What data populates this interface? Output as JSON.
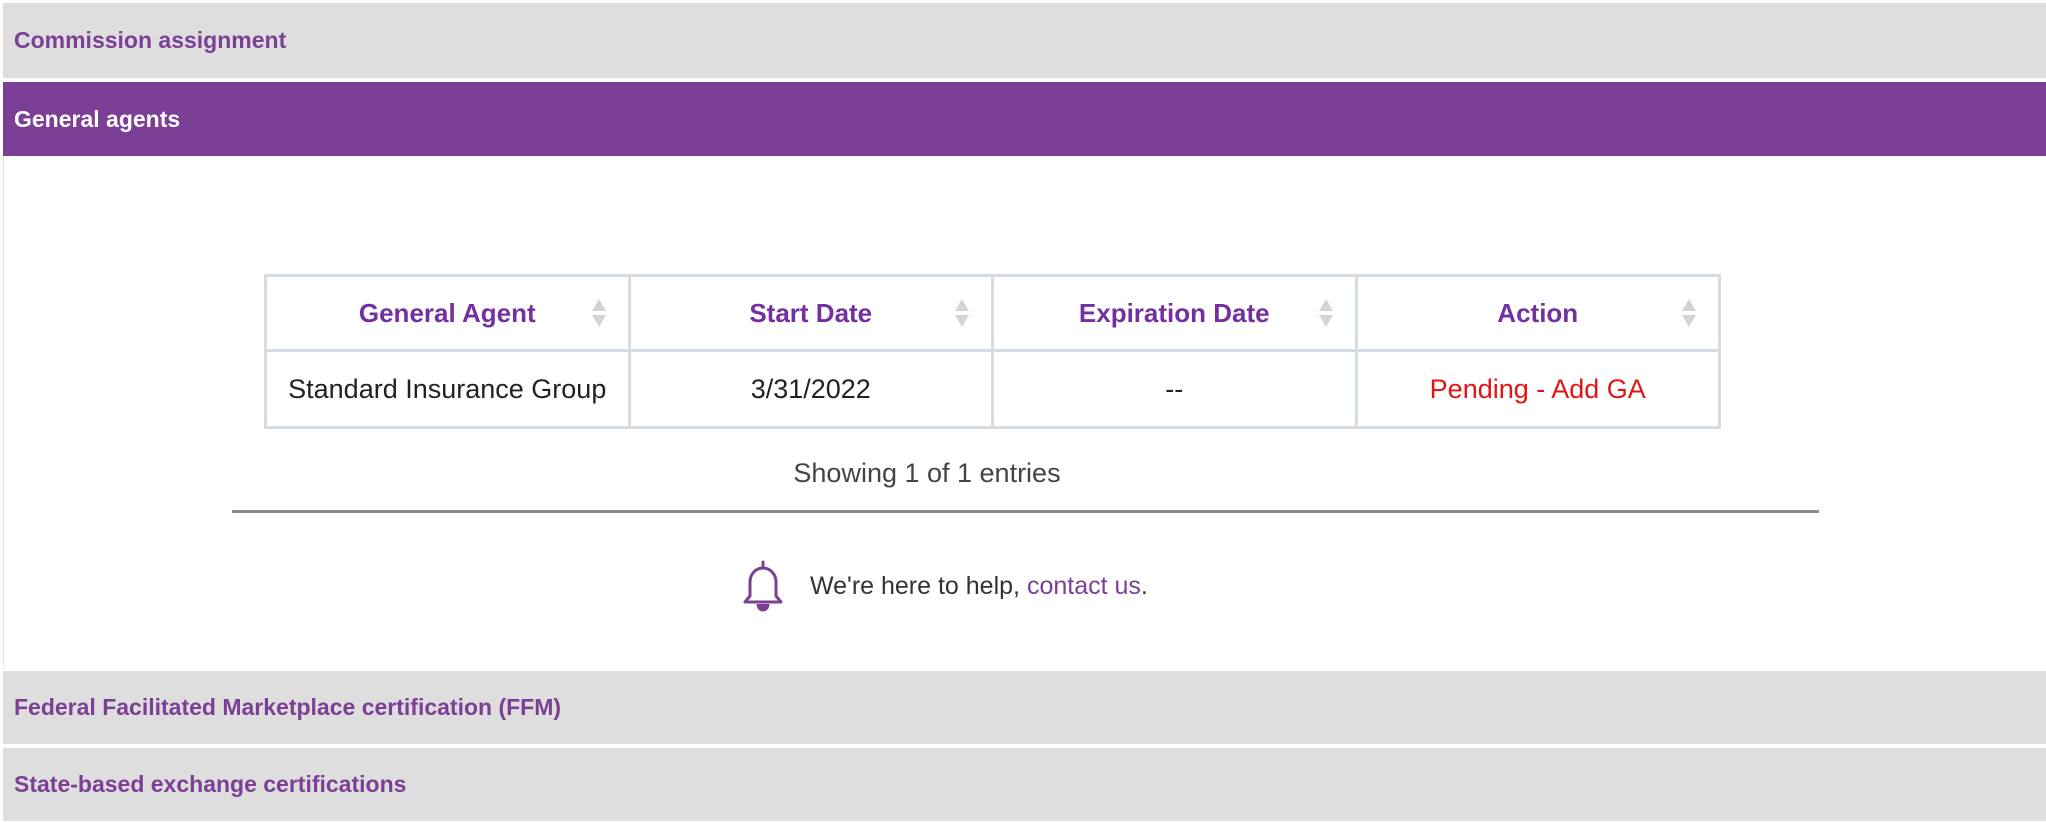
{
  "accordion": {
    "commission_label": "Commission assignment",
    "general_agents_label": "General agents",
    "ffm_label": "Federal Facilitated Marketplace certification (FFM)",
    "state_label": "State-based exchange certifications"
  },
  "general_agents_table": {
    "headers": [
      "General Agent",
      "Start Date",
      "Expiration Date",
      "Action"
    ],
    "rows": [
      {
        "general_agent": "Standard Insurance Group",
        "start_date": "3/31/2022",
        "expiration_date": "--",
        "action": "Pending - Add GA"
      }
    ],
    "entries_info": "Showing 1 of 1 entries"
  },
  "help": {
    "text": "We're here to help, ",
    "link": "contact us",
    "suffix": "."
  },
  "colors": {
    "brand_purple": "#7b3f96",
    "header_text_purple": "#7430a0",
    "pending_red": "#e31414",
    "accordion_grey": "#dedede"
  },
  "icons": {
    "sort": "sort-icon",
    "bell": "bell-icon"
  }
}
